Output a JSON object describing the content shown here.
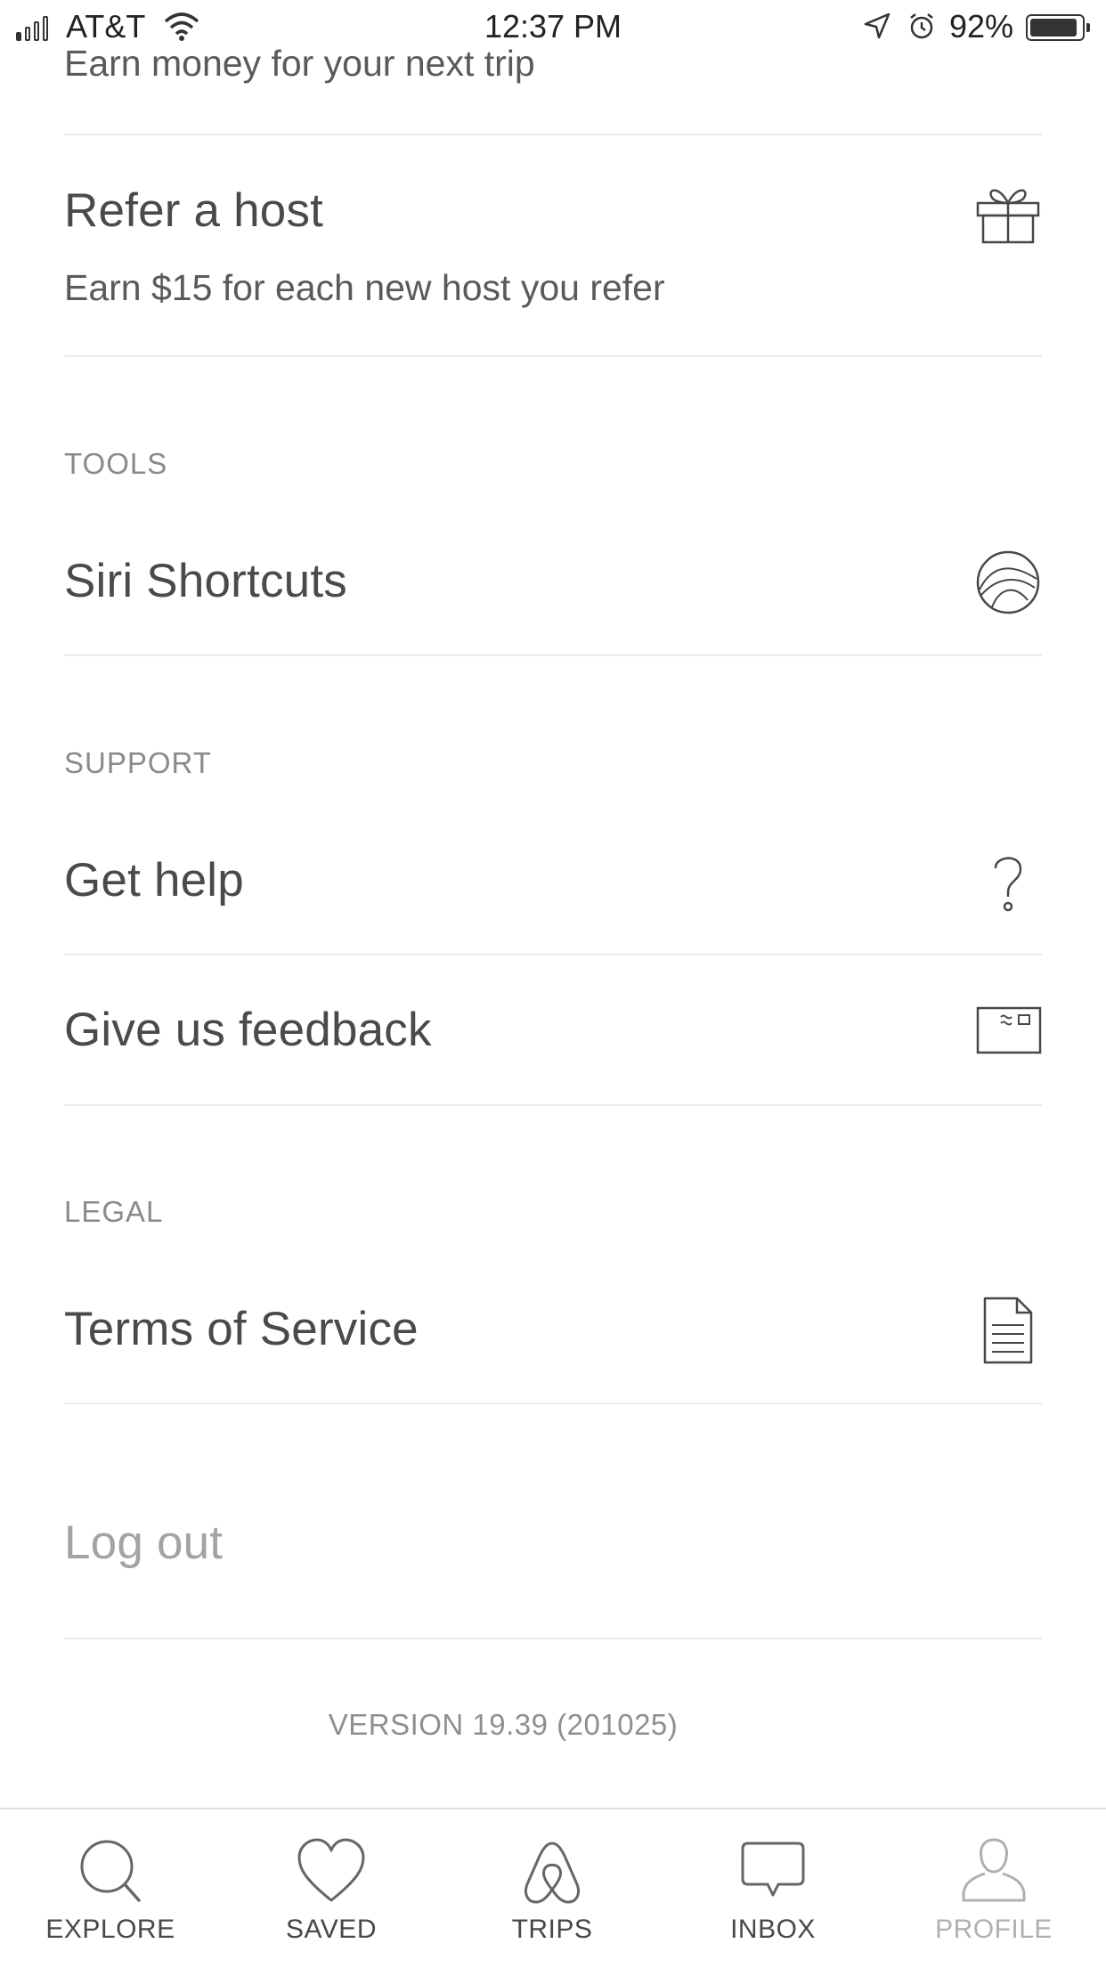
{
  "status_bar": {
    "carrier": "AT&T",
    "time": "12:37 PM",
    "battery": "92%",
    "battery_level": 0.92,
    "icons": [
      "signal-icon",
      "wifi-icon",
      "location-arrow-icon",
      "alarm-icon",
      "battery-icon"
    ]
  },
  "top_partial": {
    "subtitle": "Earn money for your next trip"
  },
  "refer": {
    "title": "Refer a host",
    "subtitle": "Earn $15 for each new host you refer",
    "icon": "gift-icon"
  },
  "sections": {
    "tools": "TOOLS",
    "support": "SUPPORT",
    "legal": "LEGAL"
  },
  "rows": {
    "siri_shortcuts": {
      "label": "Siri Shortcuts",
      "icon": "siri-icon"
    },
    "get_help": {
      "label": "Get help",
      "icon": "question-mark-icon"
    },
    "feedback": {
      "label": "Give us feedback",
      "icon": "feedback-card-icon"
    },
    "terms": {
      "label": "Terms of Service",
      "icon": "document-icon"
    }
  },
  "logout": "Log out",
  "version": "VERSION 19.39 (201025)",
  "tab_bar": {
    "tabs": [
      {
        "label": "EXPLORE",
        "icon": "search-icon"
      },
      {
        "label": "SAVED",
        "icon": "heart-icon"
      },
      {
        "label": "TRIPS",
        "icon": "airbnb-logo-icon"
      },
      {
        "label": "INBOX",
        "icon": "chat-bubble-icon"
      },
      {
        "label": "PROFILE",
        "icon": "person-icon"
      }
    ],
    "active": "PROFILE"
  }
}
